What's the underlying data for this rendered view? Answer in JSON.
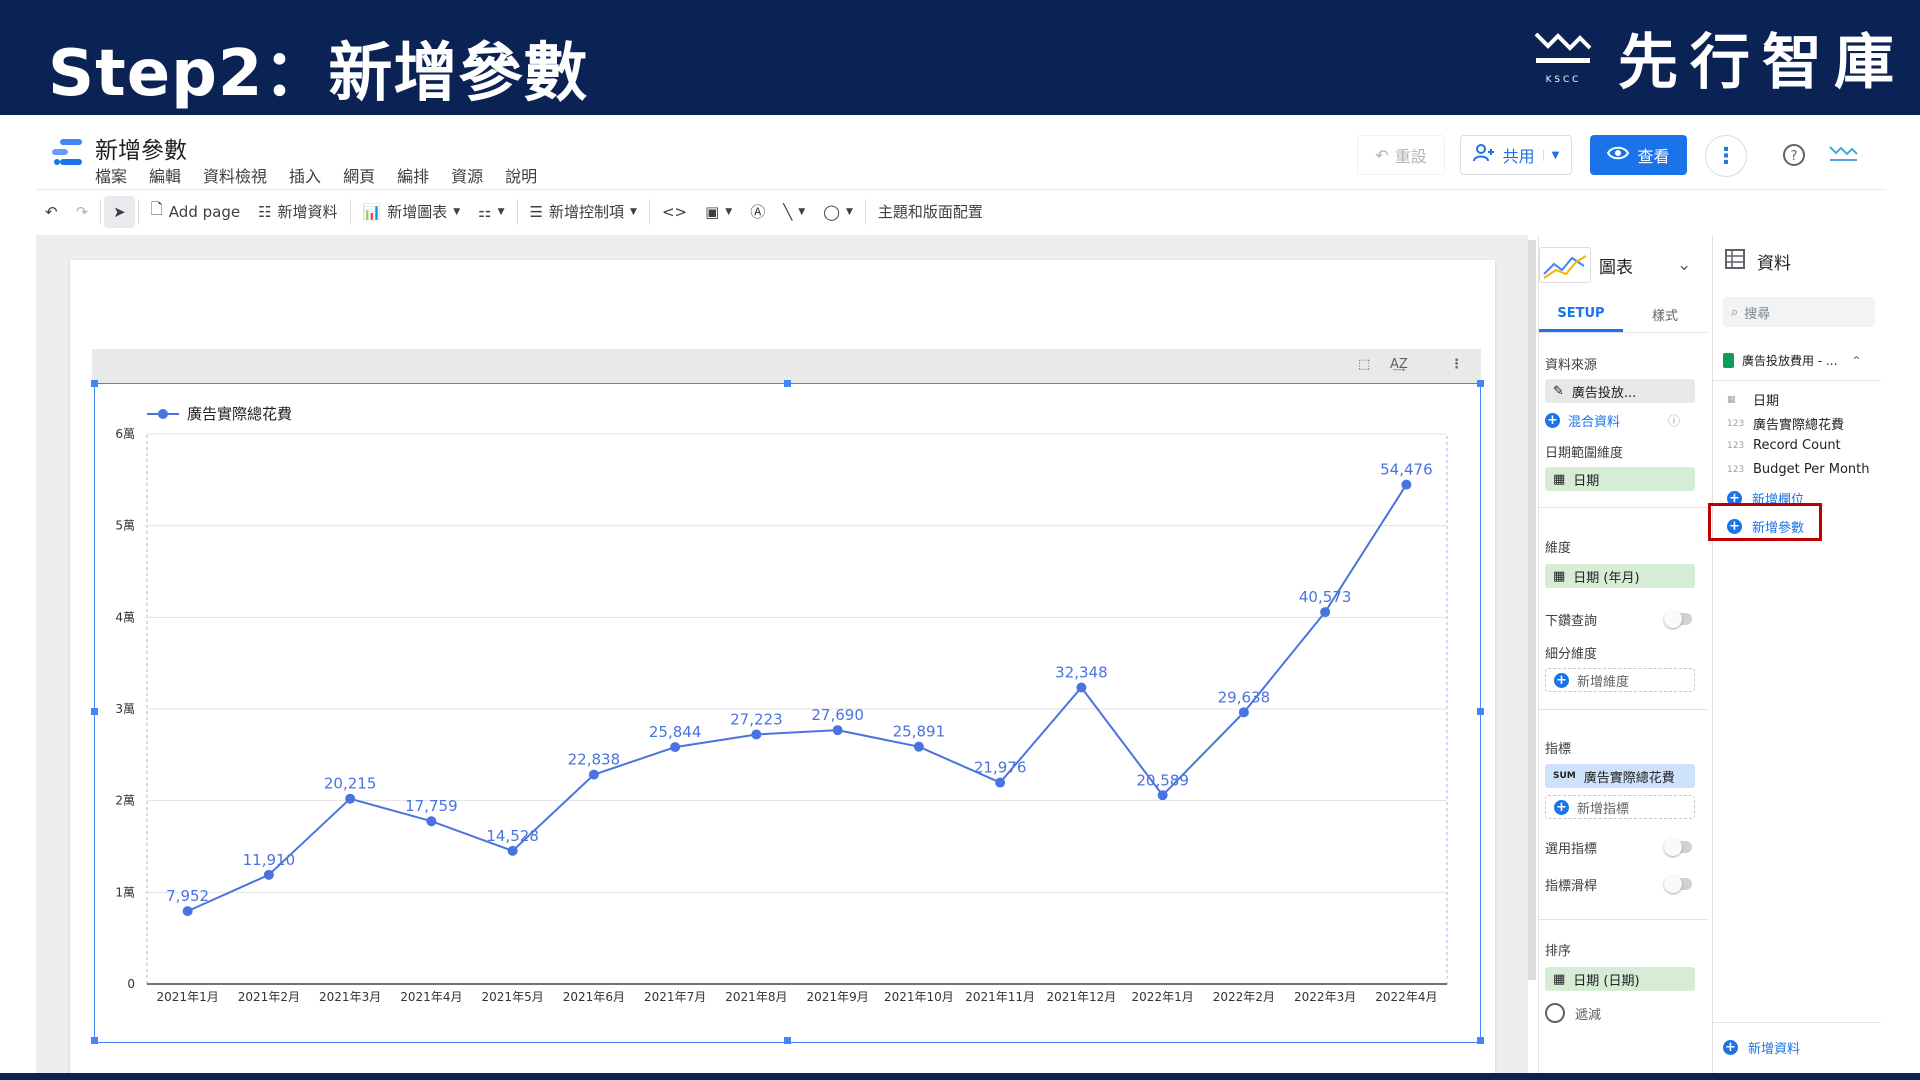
{
  "slide": {
    "title": "Step2：新增參數",
    "brand": "先行智庫",
    "brand_sub": "K S C C"
  },
  "colors": {
    "banner": "#0b2254",
    "accent": "#1a73e8",
    "line": "#4a73e0",
    "highlight": "#c00000"
  },
  "app": {
    "doc_title": "新增參數",
    "menu": [
      "檔案",
      "編輯",
      "資料檢視",
      "插入",
      "網頁",
      "編排",
      "資源",
      "說明"
    ],
    "header": {
      "reset": "重設",
      "share": "共用",
      "view": "查看"
    }
  },
  "toolbar": {
    "add_page": "Add page",
    "add_data": "新增資料",
    "add_chart": "新增圖表",
    "add_control": "新增控制項",
    "theme": "主題和版面配置"
  },
  "setup": {
    "chart_type": "圖表",
    "tab_setup": "SETUP",
    "tab_style": "樣式",
    "data_source_label": "資料來源",
    "data_source": "廣告投放...",
    "blend": "混合資料",
    "date_range_label": "日期範圍維度",
    "date_range": "日期",
    "dimension_label": "維度",
    "dimension": "日期 (年月)",
    "drilldown": "下鑽查詢",
    "breakdown_label": "細分維度",
    "add_dimension": "新增維度",
    "metric_label": "指標",
    "metric_agg": "SUM",
    "metric": "廣告實際總花費",
    "add_metric": "新增指標",
    "optional_metrics": "選用指標",
    "metric_slider": "指標滑桿",
    "sort_label": "排序",
    "sort": "日期 (日期)",
    "filter": "遞減"
  },
  "data_panel": {
    "title": "資料",
    "search_placeholder": "搜尋",
    "source": "廣告投放費用 - ...",
    "fields": [
      {
        "type": "date",
        "name": "日期"
      },
      {
        "type": "123",
        "name": "廣告實際總花費"
      },
      {
        "type": "123",
        "name": "Record Count"
      },
      {
        "type": "123",
        "name": "Budget Per Month"
      }
    ],
    "add_field": "新增欄位",
    "add_param": "新增參數",
    "add_data": "新增資料"
  },
  "chart_data": {
    "type": "line",
    "legend": "廣告實際總花費",
    "categories": [
      "2021年1月",
      "2021年2月",
      "2021年3月",
      "2021年4月",
      "2021年5月",
      "2021年6月",
      "2021年7月",
      "2021年8月",
      "2021年9月",
      "2021年10月",
      "2021年11月",
      "2021年12月",
      "2022年1月",
      "2022年2月",
      "2022年3月",
      "2022年4月"
    ],
    "values": [
      7952,
      11910,
      20215,
      17759,
      14528,
      22838,
      25844,
      27223,
      27690,
      25891,
      21976,
      32348,
      20589,
      29638,
      40573,
      54476
    ],
    "labels": [
      "7,952",
      "11,910",
      "20,215",
      "17,759",
      "14,528",
      "22,838",
      "25,844",
      "27,223",
      "27,690",
      "25,891",
      "21,976",
      "32,348",
      "20,589",
      "29,638",
      "40,573",
      "54,476"
    ],
    "y_ticks": [
      0,
      10000,
      20000,
      30000,
      40000,
      50000,
      60000
    ],
    "y_tick_labels": [
      "0",
      "1萬",
      "2萬",
      "3萬",
      "4萬",
      "5萬",
      "6萬"
    ],
    "ylim": [
      0,
      60000
    ],
    "grid": true,
    "legend_position": "top-left"
  }
}
